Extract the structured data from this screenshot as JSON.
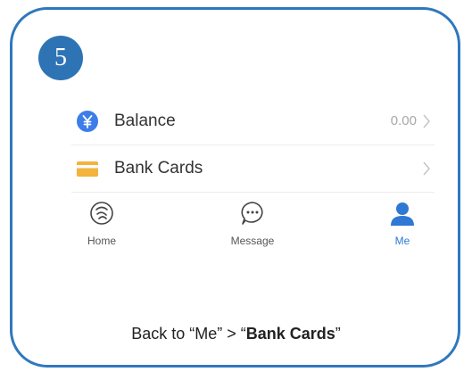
{
  "step": {
    "number": "5"
  },
  "rows": [
    {
      "label": "Balance",
      "value": "0.00",
      "icon": "yuan-circle-icon"
    },
    {
      "label": "Bank Cards",
      "value": "",
      "icon": "bank-card-icon"
    }
  ],
  "tabs": [
    {
      "label": "Home",
      "icon": "home-wallet-icon",
      "active": false
    },
    {
      "label": "Message",
      "icon": "message-bubble-icon",
      "active": false
    },
    {
      "label": "Me",
      "icon": "person-icon",
      "active": true
    }
  ],
  "caption": {
    "prefix": "Back to “Me” > “",
    "bold": "Bank Cards",
    "suffix": "”"
  },
  "colors": {
    "frame": "#2f78be",
    "badge": "#2e74b5",
    "balance_icon": "#3d7de8",
    "card_icon": "#f3b33c",
    "active_tab": "#2f78d4"
  }
}
